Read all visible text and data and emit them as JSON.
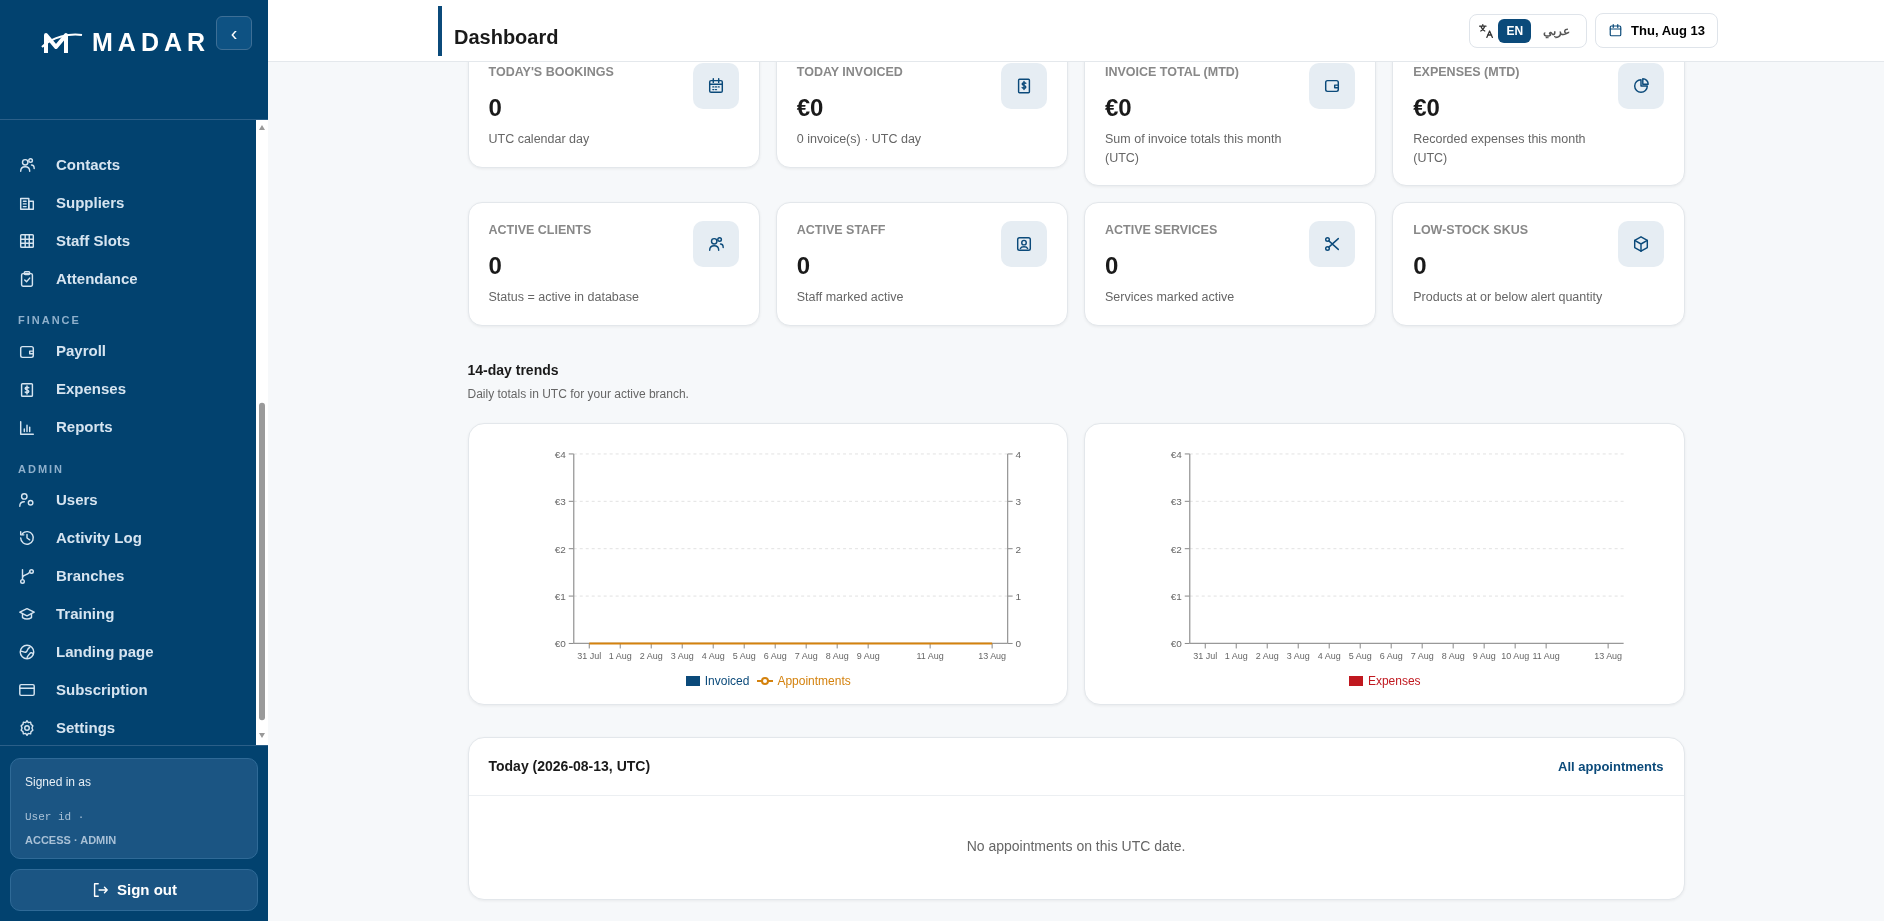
{
  "sidebar": {
    "logo": "MADAR",
    "collapse_button": "‹",
    "sections": [
      {
        "items": [
          {
            "label": "Contacts",
            "selected": false
          },
          {
            "label": "Suppliers",
            "selected": false
          },
          {
            "label": "Staff Slots",
            "selected": false
          },
          {
            "label": "Attendance",
            "selected": false
          }
        ]
      },
      {
        "heading": "FINANCE",
        "items": [
          {
            "label": "Payroll",
            "selected": false
          },
          {
            "label": "Expenses",
            "selected": false
          },
          {
            "label": "Reports",
            "selected": false
          }
        ]
      },
      {
        "heading": "ADMIN",
        "items": [
          {
            "label": "Users",
            "selected": false
          },
          {
            "label": "Activity Log",
            "selected": false
          },
          {
            "label": "Branches",
            "selected": false
          },
          {
            "label": "Training",
            "selected": false
          },
          {
            "label": "Landing page",
            "selected": false
          },
          {
            "label": "Subscription",
            "selected": false
          },
          {
            "label": "Settings",
            "selected": false
          }
        ]
      }
    ],
    "account": {
      "signed_in_label": "Signed in as",
      "user_id_label": "User id ·",
      "access": "ACCESS · ADMIN"
    },
    "sign_out": "Sign out"
  },
  "header": {
    "title": "Dashboard",
    "languages": [
      {
        "label": "EN",
        "selected": true
      },
      {
        "label": "عربي",
        "selected": false
      }
    ],
    "date": "Thu, Aug 13"
  },
  "stat_cards": [
    {
      "label": "TODAY'S BOOKINGS",
      "value": "0",
      "note": "UTC calendar day"
    },
    {
      "label": "TODAY INVOICED",
      "value": "€0",
      "note": "0 invoice(s) · UTC day"
    },
    {
      "label": "INVOICE TOTAL (MTD)",
      "value": "€0",
      "note": "Sum of invoice totals this month (UTC)"
    },
    {
      "label": "EXPENSES (MTD)",
      "value": "€0",
      "note": "Recorded expenses this month (UTC)"
    },
    {
      "label": "ACTIVE CLIENTS",
      "value": "0",
      "note": "Status = active in database"
    },
    {
      "label": "ACTIVE STAFF",
      "value": "0",
      "note": "Staff marked active"
    },
    {
      "label": "ACTIVE SERVICES",
      "value": "0",
      "note": "Services marked active"
    },
    {
      "label": "LOW-STOCK SKUS",
      "value": "0",
      "note": "Products at or below alert quantity"
    }
  ],
  "trends": {
    "title": "14-day trends",
    "subtitle": "Daily totals in UTC for your active branch.",
    "charts": [
      {
        "chart_data": {
          "type": "bar",
          "categories": [
            "31 Jul",
            "1 Aug",
            "2 Aug",
            "3 Aug",
            "4 Aug",
            "5 Aug",
            "6 Aug",
            "7 Aug",
            "8 Aug",
            "9 Aug",
            null,
            "11 Aug",
            null,
            "13 Aug"
          ],
          "grid": true,
          "ylim": [
            0,
            4
          ],
          "y2lim": [
            0,
            4
          ],
          "yticks": [
            {
              "value": 0,
              "label": "€0"
            },
            {
              "value": 1,
              "label": "€1"
            },
            {
              "value": 2,
              "label": "€2"
            },
            {
              "value": 3,
              "label": "€3"
            },
            {
              "value": 4,
              "label": "€4"
            }
          ],
          "y2ticks": [
            0,
            1,
            2,
            3,
            4
          ],
          "series": [
            {
              "name": "Invoiced",
              "type": "bar",
              "color": "#0b4a7a",
              "values": [
                0,
                0,
                0,
                0,
                0,
                0,
                0,
                0,
                0,
                0,
                0,
                0,
                0,
                0
              ]
            },
            {
              "name": "Appointments",
              "type": "line",
              "color": "#d4820e",
              "values": [
                0,
                0,
                0,
                0,
                0,
                0,
                0,
                0,
                0,
                0,
                0,
                0,
                0,
                0
              ]
            }
          ]
        }
      },
      {
        "chart_data": {
          "type": "bar",
          "categories": [
            "31 Jul",
            "1 Aug",
            "2 Aug",
            "3 Aug",
            "4 Aug",
            "5 Aug",
            "6 Aug",
            "7 Aug",
            "8 Aug",
            "9 Aug",
            "10 Aug",
            "11 Aug",
            null,
            "13 Aug"
          ],
          "grid": true,
          "ylim": [
            0,
            4
          ],
          "yticks": [
            {
              "value": 0,
              "label": "€0"
            },
            {
              "value": 1,
              "label": "€1"
            },
            {
              "value": 2,
              "label": "€2"
            },
            {
              "value": 3,
              "label": "€3"
            },
            {
              "value": 4,
              "label": "€4"
            }
          ],
          "series": [
            {
              "name": "Expenses",
              "color": "#c0181f",
              "values": [
                0,
                0,
                0,
                0,
                0,
                0,
                0,
                0,
                0,
                0,
                0,
                0,
                0,
                0
              ]
            }
          ]
        }
      }
    ]
  },
  "today": {
    "title": "Today (2026-08-13, UTC)",
    "link": "All appointments",
    "empty": "No appointments on this UTC date."
  }
}
